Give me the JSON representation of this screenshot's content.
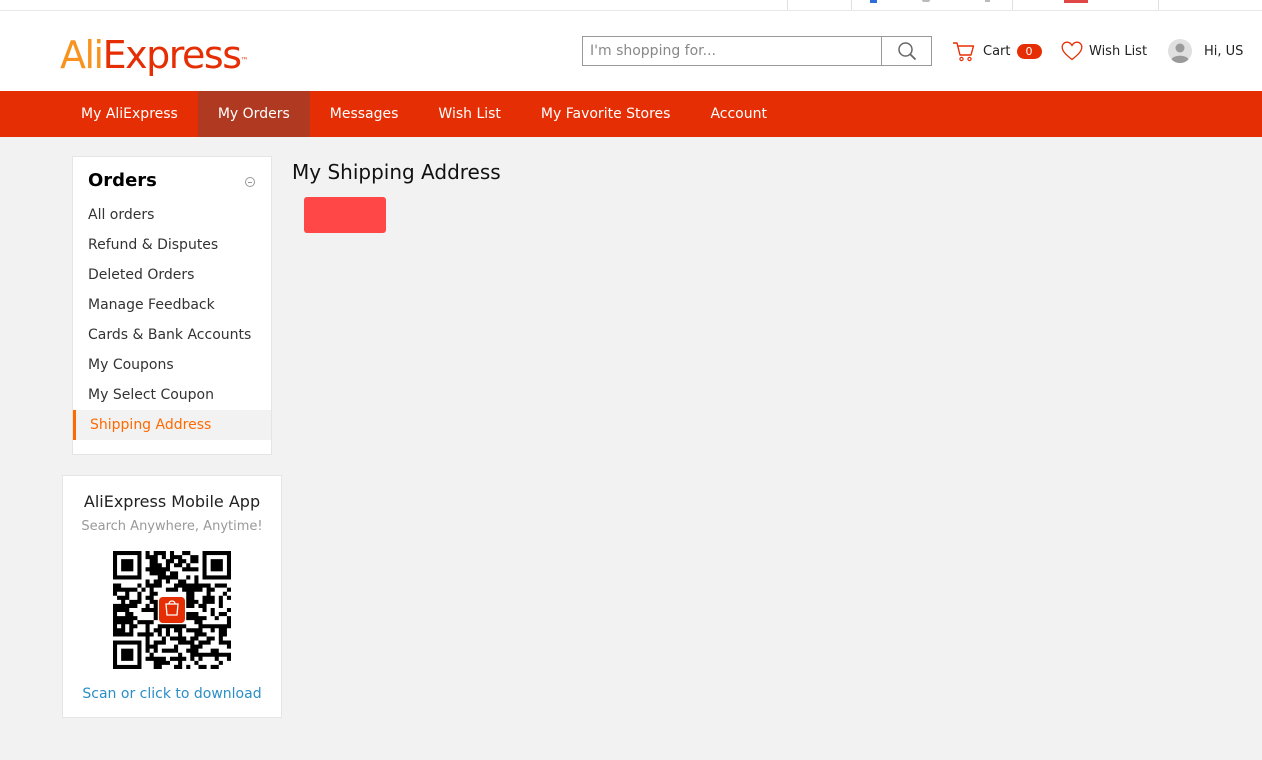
{
  "logo": {
    "part_a": "Ali",
    "part_b": "Express",
    "tm": "™"
  },
  "search": {
    "placeholder": "I'm shopping for...",
    "icon": "search-icon"
  },
  "header": {
    "cart_label": "Cart",
    "cart_count": "0",
    "wishlist_label": "Wish List",
    "user_greeting": "Hi, US"
  },
  "nav": {
    "items": [
      {
        "label": "My AliExpress"
      },
      {
        "label": "My Orders"
      },
      {
        "label": "Messages"
      },
      {
        "label": "Wish List"
      },
      {
        "label": "My Favorite Stores"
      },
      {
        "label": "Account"
      }
    ],
    "active_index": 1
  },
  "sidebar": {
    "title": "Orders",
    "items": [
      {
        "label": "All orders"
      },
      {
        "label": "Refund & Disputes"
      },
      {
        "label": "Deleted Orders"
      },
      {
        "label": "Manage Feedback"
      },
      {
        "label": "Cards & Bank Accounts"
      },
      {
        "label": "My Coupons"
      },
      {
        "label": "My Select Coupon"
      },
      {
        "label": "Shipping Address"
      }
    ],
    "active_index": 7
  },
  "app_promo": {
    "title": "AliExpress Mobile App",
    "subtitle": "Search Anywhere, Anytime!",
    "link": "Scan or click to download"
  },
  "main": {
    "title": "My Shipping Address"
  },
  "colors": {
    "brand_red": "#e62e04",
    "brand_orange": "#f7931e",
    "nav_active": "#b03a21",
    "accent_orange": "#ff6a00",
    "button_red": "#ff4747",
    "link_blue": "#2a8fc7"
  }
}
